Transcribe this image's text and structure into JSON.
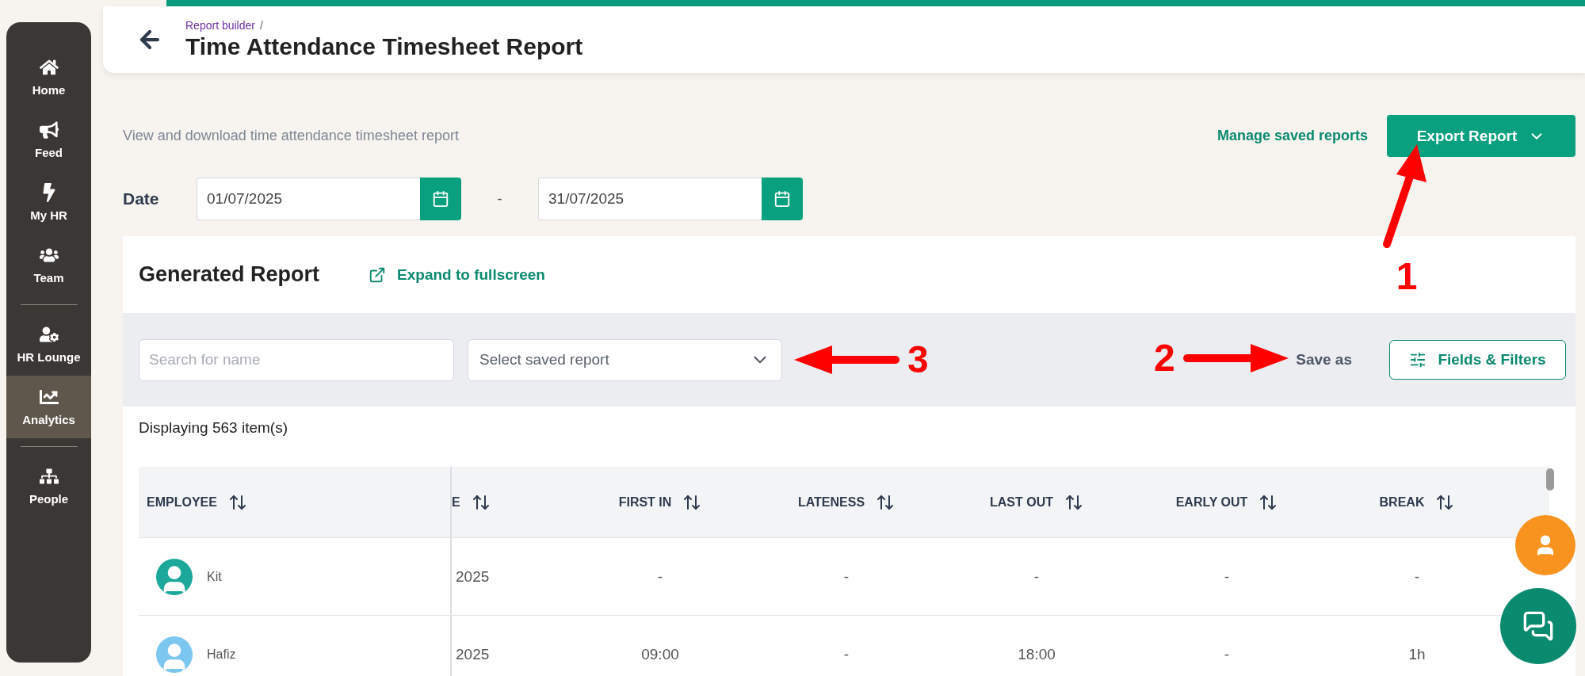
{
  "sidebar": {
    "groups": [
      [
        {
          "label": "Home",
          "selected": false
        },
        {
          "label": "Feed",
          "selected": false
        },
        {
          "label": "My HR",
          "selected": false
        },
        {
          "label": "Team",
          "selected": false
        }
      ],
      [
        {
          "label": "HR Lounge",
          "selected": false
        },
        {
          "label": "Analytics",
          "selected": true
        }
      ],
      [
        {
          "label": "People",
          "selected": false
        }
      ]
    ]
  },
  "header": {
    "breadcrumb": "Report builder",
    "separator": "/",
    "title": "Time Attendance Timesheet Report"
  },
  "subtitle": "View and download time attendance timesheet report",
  "manage_link": "Manage saved reports",
  "export_button": "Export Report",
  "date": {
    "label": "Date",
    "from": "01/07/2025",
    "separator": "-",
    "to": "31/07/2025"
  },
  "report": {
    "title": "Generated Report",
    "expand_link": "Expand to fullscreen",
    "search": {
      "placeholder": "Search for name"
    },
    "saved_select": {
      "placeholder": "Select saved report"
    },
    "save_as": "Save as",
    "fields_button": "Fields & Filters",
    "count": "Displaying 563 item(s)"
  },
  "table": {
    "columns": [
      "EMPLOYEE",
      "E",
      "FIRST IN",
      "LATENESS",
      "LAST OUT",
      "EARLY OUT",
      "BREAK"
    ],
    "rows": [
      {
        "cells": [
          "Kit",
          "2025",
          "-",
          "-",
          "-",
          "-",
          "-"
        ]
      },
      {
        "cells": [
          "Hafiz",
          "2025",
          "09:00",
          "-",
          "18:00",
          "-",
          "1h"
        ]
      }
    ]
  },
  "annotations": [
    {
      "label": "1"
    },
    {
      "label": "2"
    },
    {
      "label": "3"
    }
  ]
}
